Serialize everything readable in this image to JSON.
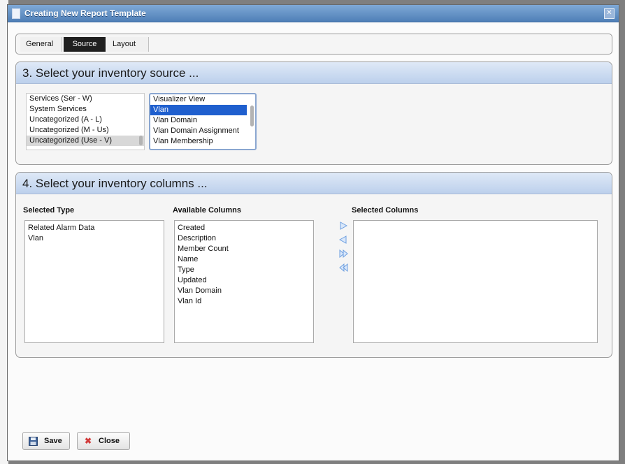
{
  "dialog": {
    "title": "Creating New Report Template",
    "close_glyph": "✕"
  },
  "tabs": [
    {
      "label": "General",
      "active": false
    },
    {
      "label": "Source",
      "active": true
    },
    {
      "label": "Layout",
      "active": false
    }
  ],
  "source_panel": {
    "title": "3. Select your inventory source ...",
    "category_list": [
      "Services (Ser - W)",
      "System Services",
      "Uncategorized (A - L)",
      "Uncategorized (M - Us)",
      "Uncategorized (Use - V)"
    ],
    "category_selected": "Uncategorized (Use - V)",
    "type_list": [
      "Visualizer View",
      "Vlan",
      "Vlan Domain",
      "Vlan Domain Assignment",
      "Vlan Membership"
    ],
    "type_selected": "Vlan"
  },
  "columns_panel": {
    "title": "4. Select your inventory columns ...",
    "selected_type_label": "Selected Type",
    "available_columns_label": "Available Columns",
    "selected_columns_label": "Selected Columns",
    "selected_types": [
      "Related Alarm Data",
      "Vlan"
    ],
    "available_columns": [
      "Created",
      "Description",
      "Member Count",
      "Name",
      "Type",
      "Updated",
      "Vlan Domain",
      "Vlan Id"
    ],
    "selected_columns": []
  },
  "footer": {
    "save_label": "Save",
    "close_label": "Close"
  },
  "colors": {
    "titlebar": "#5a89c2",
    "selection_blue": "#1f5fce",
    "arrow_blue": "#6d9fe0"
  }
}
